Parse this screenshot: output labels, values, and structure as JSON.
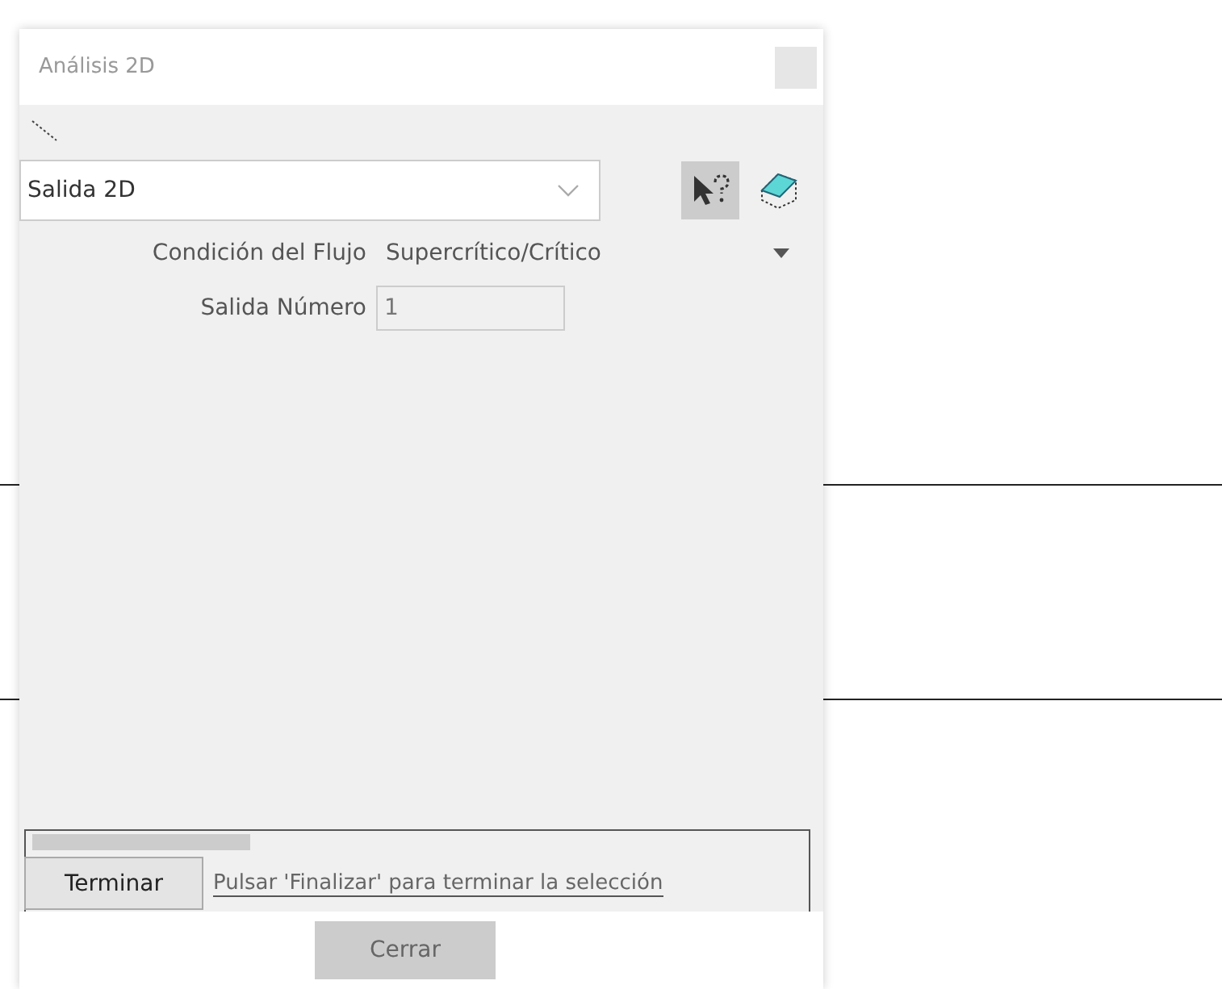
{
  "window": {
    "title": "Análisis 2D"
  },
  "selector": {
    "value": "Salida 2D"
  },
  "fields": [
    {
      "kind": "dropdown",
      "label": "Condición del Flujo",
      "value": "Supercrítico/Crítico"
    },
    {
      "kind": "input",
      "label": "Salida Número",
      "value": "1"
    }
  ],
  "prompt": {
    "button": "Terminar",
    "message": "Pulsar 'Finalizar' para terminar la selección"
  },
  "buttons": [
    "Cerrar"
  ]
}
